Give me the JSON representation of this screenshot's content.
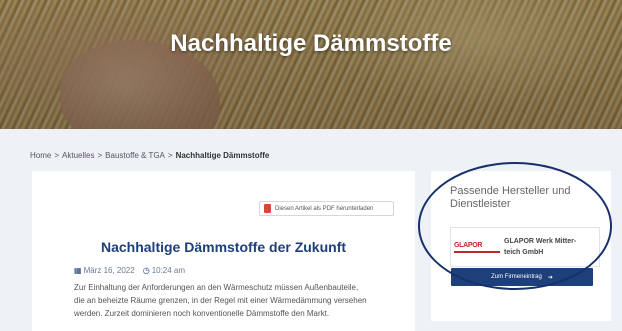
{
  "hero": {
    "title": "Nachhaltige Dämmstoffe"
  },
  "breadcrumb": {
    "items": [
      "Home",
      "Aktuelles",
      "Baustoffe & TGA",
      "Nachhaltige Dämmstoffe"
    ],
    "separator": ">"
  },
  "article": {
    "pdf_label": "Diesen Artikel als PDF herunterladen",
    "title": "Nachhaltige Dämmstoffe der Zukunft",
    "date": "März 16, 2022",
    "time": "10:24 am",
    "excerpt_lines": [
      "Zur Einhaltung der Anforderungen an den Wärmeschutz müssen Außenbauteile,",
      "die an beheizte Räume grenzen, in der Regel mit einer Wärmedämmung versehen",
      "werden. Zurzeit dominieren noch konventionelle Dämmstoffe den Markt."
    ]
  },
  "sidebar": {
    "title": "Passende Hersteller und Dienstleister",
    "company_logo": "GLAPOR",
    "company_name_line1": "GLAPOR Werk Mitter-",
    "company_name_line2": "teich GmbH",
    "cta_label": "Zum Firmeneintrag",
    "cta_icon": "arrow-right-icon"
  },
  "colors": {
    "accent": "#1d3f7a",
    "logo_red": "#c0282e",
    "background": "#eef1f6"
  }
}
